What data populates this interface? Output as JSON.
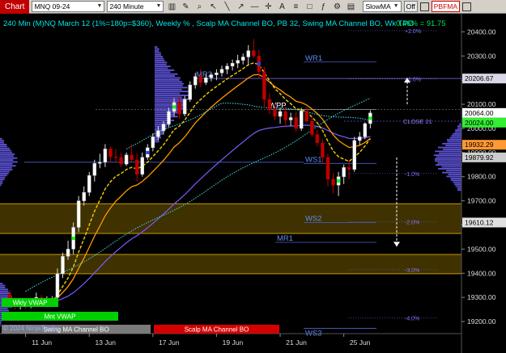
{
  "toolbar": {
    "chart_label": "Chart",
    "symbol": "MNQ 09-24",
    "interval": "240 Minute",
    "indicator": "SlowMA",
    "indicator_state": "Off",
    "study": "PBFMA"
  },
  "colors": {
    "background": "#000000",
    "title_text": "#00e5e5",
    "bid_green": "#00c000",
    "down_red": "#c00000",
    "band_gold": "#a07800",
    "swing_ma": "#f5c542",
    "scalp_ma": "#ff9900",
    "slow_ma": "#7a5cff",
    "vwap": "#40d0d0",
    "volume_profile": "#8a7cff"
  },
  "chart_data": {
    "type": "candlestick",
    "title": "240 Min (M)NQ March 12 (1%=180p=$360), Weekly % , Scalp MA Channel BO, PB 32, Swing MA Channel BO, Wk TPO",
    "change_readout": "0.46% = 91.75",
    "ylim": [
      19150,
      20475
    ],
    "y_ticks": [
      {
        "value": 20400,
        "label": "20400.00"
      },
      {
        "value": 20300,
        "label": "20300.00"
      },
      {
        "value": 20200,
        "label": "20200.00"
      },
      {
        "value": 20100,
        "label": "20100.00"
      },
      {
        "value": 20000,
        "label": "20000.00"
      },
      {
        "value": 19900,
        "label": "19900.00"
      },
      {
        "value": 19800,
        "label": "19800.00"
      },
      {
        "value": 19700,
        "label": "19700.00"
      },
      {
        "value": 19600,
        "label": "19600.00"
      },
      {
        "value": 19500,
        "label": "19500.00"
      },
      {
        "value": 19400,
        "label": "19400.00"
      },
      {
        "value": 19300,
        "label": "19300.00"
      },
      {
        "value": 19200,
        "label": "19200.00"
      }
    ],
    "x_ticks": [
      {
        "bar": 3,
        "label": "11 Jun"
      },
      {
        "bar": 15,
        "label": "13 Jun"
      },
      {
        "bar": 27,
        "label": "17 Jun"
      },
      {
        "bar": 39,
        "label": "19 Jun"
      },
      {
        "bar": 51,
        "label": "21 Jun"
      },
      {
        "bar": 63,
        "label": "25 Jun"
      }
    ],
    "price_tags": [
      {
        "value": 20206.67,
        "label": "20206.67",
        "bg": "#d8d8e8",
        "fg": "#000000"
      },
      {
        "value": 20064.0,
        "label": "20064.00",
        "bg": "#ffffff",
        "fg": "#000000"
      },
      {
        "value": 20024.0,
        "label": "20024.00",
        "bg": "#33ee33",
        "fg": "#000000"
      },
      {
        "value": 19932.29,
        "label": "19932.29",
        "bg": "#ff9933",
        "fg": "#000000"
      },
      {
        "value": 19879.92,
        "label": "19879.92",
        "bg": "#cccccc",
        "fg": "#000000"
      },
      {
        "value": 19610.12,
        "label": "19610.12",
        "bg": "#e0e0e0",
        "fg": "#000000"
      }
    ],
    "percent_levels": [
      {
        "value": 20405,
        "label": "+2.0%"
      },
      {
        "value": 20205,
        "label": "+1.0%"
      },
      {
        "value": 19813,
        "label": "-1.0%"
      },
      {
        "value": 19614,
        "label": "-2.0%"
      },
      {
        "value": 19415,
        "label": "-3.0%"
      },
      {
        "value": 19216,
        "label": "-4.0%"
      }
    ],
    "pivot_lines": [
      {
        "value": 20275,
        "label": "WR1"
      },
      {
        "value": 20207,
        "label": "MR2"
      },
      {
        "value": 20078,
        "label": "WPP"
      },
      {
        "value": 20030,
        "label": "CLOSE 21"
      },
      {
        "value": 19855,
        "label": "WS1"
      },
      {
        "value": 19610,
        "label": "WS2"
      },
      {
        "value": 19528,
        "label": "MR1"
      },
      {
        "value": 19172,
        "label": "WS3"
      }
    ],
    "bands": [
      {
        "low": 19565,
        "high": 19688
      },
      {
        "low": 19398,
        "high": 19478
      }
    ],
    "labels_bottom": [
      {
        "label": "Wkly VWAP",
        "bg": "#00d000"
      },
      {
        "label": "Mnt VWAP",
        "bg": "#00d000"
      },
      {
        "label": "Swing MA Channel BO",
        "bg": "#7a7a7a"
      },
      {
        "label": "Scalp MA Channel BO",
        "bg": "#d40000"
      }
    ],
    "copyright": "© 2024 NinjaTrader",
    "candles": [
      [
        19312,
        19330,
        19262,
        19280
      ],
      [
        19280,
        19300,
        19250,
        19266
      ],
      [
        19266,
        19290,
        19250,
        19278
      ],
      [
        19278,
        19295,
        19252,
        19262
      ],
      [
        19262,
        19295,
        19255,
        19285
      ],
      [
        19285,
        19320,
        19270,
        19300
      ],
      [
        19300,
        19310,
        19262,
        19270
      ],
      [
        19270,
        19305,
        19260,
        19290
      ],
      [
        19290,
        19305,
        19278,
        19296
      ],
      [
        19300,
        19420,
        19290,
        19398
      ],
      [
        19398,
        19485,
        19380,
        19470
      ],
      [
        19470,
        19535,
        19455,
        19500
      ],
      [
        19500,
        19610,
        19480,
        19590
      ],
      [
        19590,
        19720,
        19570,
        19700
      ],
      [
        19700,
        19760,
        19680,
        19735
      ],
      [
        19735,
        19820,
        19720,
        19805
      ],
      [
        19805,
        19870,
        19780,
        19855
      ],
      [
        19855,
        19895,
        19835,
        19860
      ],
      [
        19860,
        19935,
        19840,
        19915
      ],
      [
        19915,
        19925,
        19860,
        19882
      ],
      [
        19882,
        19915,
        19860,
        19880
      ],
      [
        19880,
        19900,
        19840,
        19852
      ],
      [
        19852,
        19900,
        19845,
        19890
      ],
      [
        19890,
        19935,
        19860,
        19870
      ],
      [
        19870,
        19895,
        19780,
        19810
      ],
      [
        19810,
        19900,
        19800,
        19880
      ],
      [
        19880,
        19935,
        19870,
        19920
      ],
      [
        19920,
        19980,
        19905,
        19965
      ],
      [
        19965,
        20010,
        19950,
        19990
      ],
      [
        19990,
        20030,
        19975,
        20018
      ],
      [
        20018,
        20085,
        20005,
        20070
      ],
      [
        20070,
        20125,
        20050,
        20108
      ],
      [
        20108,
        20135,
        20040,
        20060
      ],
      [
        20060,
        20135,
        20050,
        20120
      ],
      [
        20120,
        20195,
        20110,
        20180
      ],
      [
        20180,
        20230,
        20165,
        20215
      ],
      [
        20215,
        20245,
        20170,
        20190
      ],
      [
        20190,
        20225,
        20180,
        20210
      ],
      [
        20210,
        20230,
        20195,
        20222
      ],
      [
        20222,
        20245,
        20200,
        20230
      ],
      [
        20230,
        20260,
        20215,
        20245
      ],
      [
        20245,
        20270,
        20225,
        20258
      ],
      [
        20258,
        20285,
        20240,
        20270
      ],
      [
        20270,
        20305,
        20250,
        20282
      ],
      [
        20282,
        20310,
        20265,
        20296
      ],
      [
        20296,
        20345,
        20260,
        20322
      ],
      [
        20322,
        20370,
        20290,
        20300
      ],
      [
        20300,
        20325,
        20210,
        20235
      ],
      [
        20235,
        20255,
        20085,
        20120
      ],
      [
        20120,
        20145,
        20060,
        20078
      ],
      [
        20078,
        20105,
        20035,
        20050
      ],
      [
        20050,
        20085,
        20020,
        20070
      ],
      [
        20070,
        20090,
        20005,
        20035
      ],
      [
        20035,
        20065,
        20010,
        20045
      ],
      [
        20045,
        20070,
        19985,
        20000
      ],
      [
        20000,
        20085,
        19990,
        20072
      ],
      [
        20072,
        20090,
        20025,
        20030
      ],
      [
        20030,
        20050,
        19965,
        19975
      ],
      [
        19975,
        19995,
        19925,
        19940
      ],
      [
        19940,
        19955,
        19855,
        19880
      ],
      [
        19880,
        19895,
        19760,
        19790
      ],
      [
        19790,
        19815,
        19730,
        19765
      ],
      [
        19765,
        19820,
        19720,
        19800
      ],
      [
        19800,
        19850,
        19770,
        19838
      ],
      [
        19838,
        19870,
        19790,
        19830
      ],
      [
        19830,
        19965,
        19820,
        19950
      ],
      [
        19950,
        19985,
        19930,
        19965
      ],
      [
        19965,
        20025,
        19955,
        20020
      ],
      [
        20020,
        20075,
        20000,
        20064
      ]
    ]
  }
}
